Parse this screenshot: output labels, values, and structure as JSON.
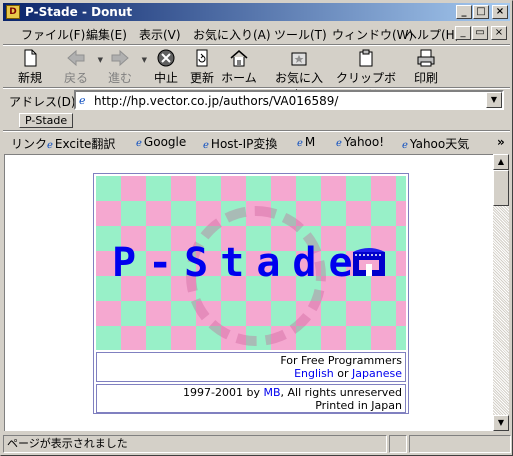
{
  "window": {
    "title": "P-Stade - Donut"
  },
  "menu": {
    "items": [
      "ファイル(F)",
      "編集(E)",
      "表示(V)",
      "お気に入り(A)",
      "ツール(T)",
      "ウィンドウ(W)",
      "ヘルプ(H)"
    ]
  },
  "toolbar": {
    "new": "新規",
    "back": "戻る",
    "forward": "進む",
    "stop": "中止",
    "refresh": "更新",
    "home": "ホーム",
    "favorites": "お気に入り",
    "clipboard": "クリップボード",
    "print": "印刷"
  },
  "address": {
    "label": "アドレス(D)",
    "url": "http://hp.vector.co.jp/authors/VA016589/"
  },
  "tabs": [
    "P-Stade"
  ],
  "links": {
    "label": "リンク",
    "items": [
      "Excite翻訳",
      "Google",
      "Host-IP変換",
      "M",
      "Yahoo!",
      "Yahoo天気"
    ]
  },
  "page": {
    "logo_text": "P-Stade",
    "tagline": "For Free Programmers",
    "lang_english": "English",
    "lang_or": " or ",
    "lang_japanese": "Japanese",
    "copyright_prefix": "1997-2001 by ",
    "author": "MB",
    "copyright_suffix": ", All rights unreserved",
    "printed": "Printed in Japan"
  },
  "status": {
    "text": "ページが表示されました"
  },
  "colors": {
    "checker_pink": "#f5a8d0",
    "checker_green": "#98f0c8",
    "logo_blue": "#0000ee"
  }
}
